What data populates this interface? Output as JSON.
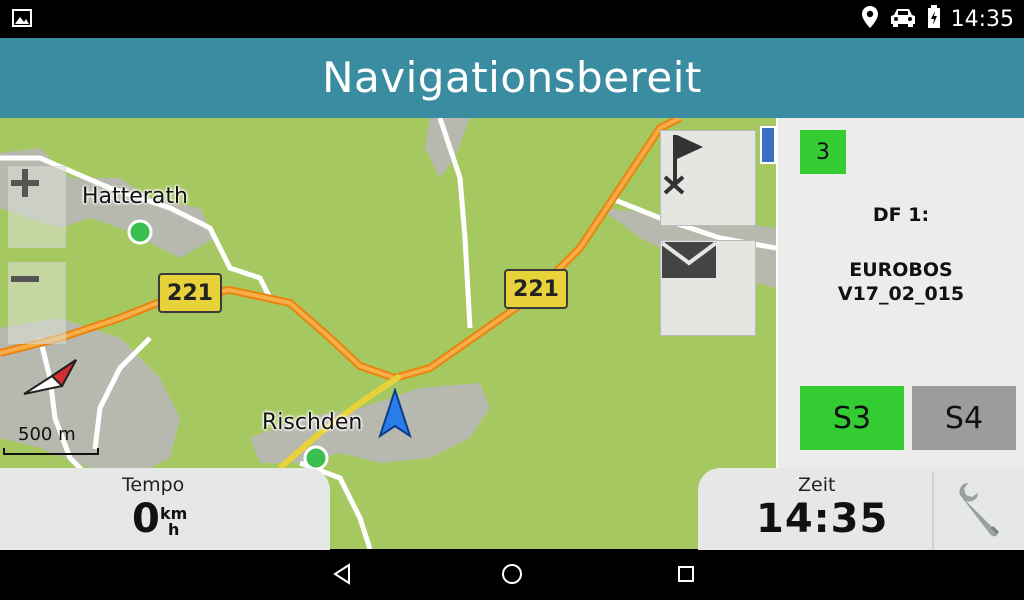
{
  "status_bar": {
    "time": "14:35",
    "icons": [
      "image-icon",
      "location-pin-icon",
      "car-icon",
      "battery-icon"
    ]
  },
  "header": {
    "title": "Navigationsbereit"
  },
  "map": {
    "places": [
      "Hatterath",
      "Rischden"
    ],
    "road_shields": [
      "221",
      "221"
    ],
    "scale": "500 m",
    "zoom_in_icon": "plus-icon",
    "zoom_out_icon": "minus-icon"
  },
  "side_panel": {
    "badge": "3",
    "df_label": "DF 1:",
    "df_value_line1": "EUROBOS",
    "df_value_line2": "V17_02_015",
    "s3_label": "S3",
    "s4_label": "S4",
    "colors": {
      "active": "#33cc33",
      "inactive": "#9c9c9c"
    }
  },
  "bottom": {
    "tempo_label": "Tempo",
    "speed_value": "0",
    "speed_unit_top": "km",
    "speed_unit_bottom": "h",
    "zeit_label": "Zeit",
    "clock": "14:35"
  },
  "colors": {
    "header": "#3a8ca0",
    "map_green": "#a6c860",
    "route": "#f0901a"
  }
}
